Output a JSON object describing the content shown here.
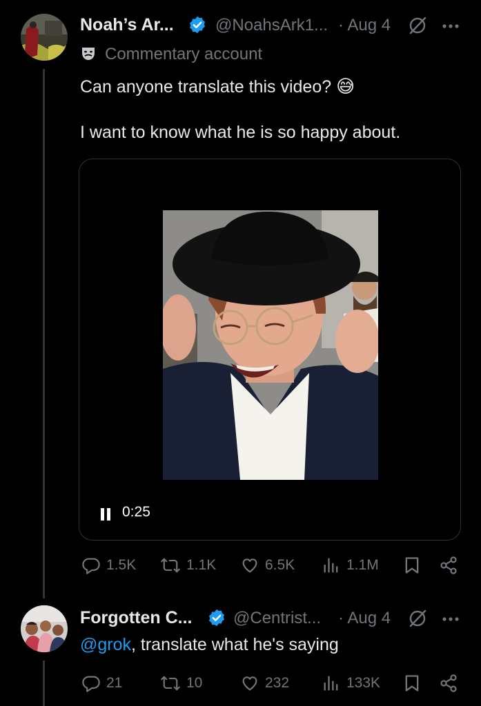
{
  "tweet1": {
    "name": "Noah’s Ar...",
    "handle": "@NoahsArk1...",
    "date": "· Aug 4",
    "label": "Commentary account",
    "text_line1": "Can anyone translate this video?",
    "text_emoji": "😅",
    "text_line2": "I want to know what he is so happy about.",
    "video": {
      "state": "playing",
      "time": "0:25"
    },
    "stats": {
      "replies": "1.5K",
      "reposts": "1.1K",
      "likes": "6.5K",
      "views": "1.1M"
    }
  },
  "tweet2": {
    "name": "Forgotten C...",
    "handle": "@Centrist...",
    "date": "· Aug 4",
    "mention": "@grok",
    "text_rest": ", translate what he's saying",
    "stats": {
      "replies": "21",
      "reposts": "10",
      "likes": "232",
      "views": "133K"
    }
  },
  "colors": {
    "background": "#000000",
    "text": "#e7e9ea",
    "secondary": "#71767b",
    "accent": "#1d9bf0",
    "verified": "#1d9bf0"
  },
  "icons": [
    "verified-badge-icon",
    "grok-icon",
    "more-icon",
    "theater-mask-icon",
    "pause-icon",
    "reply-icon",
    "repost-icon",
    "like-icon",
    "views-icon",
    "bookmark-icon",
    "share-icon"
  ]
}
